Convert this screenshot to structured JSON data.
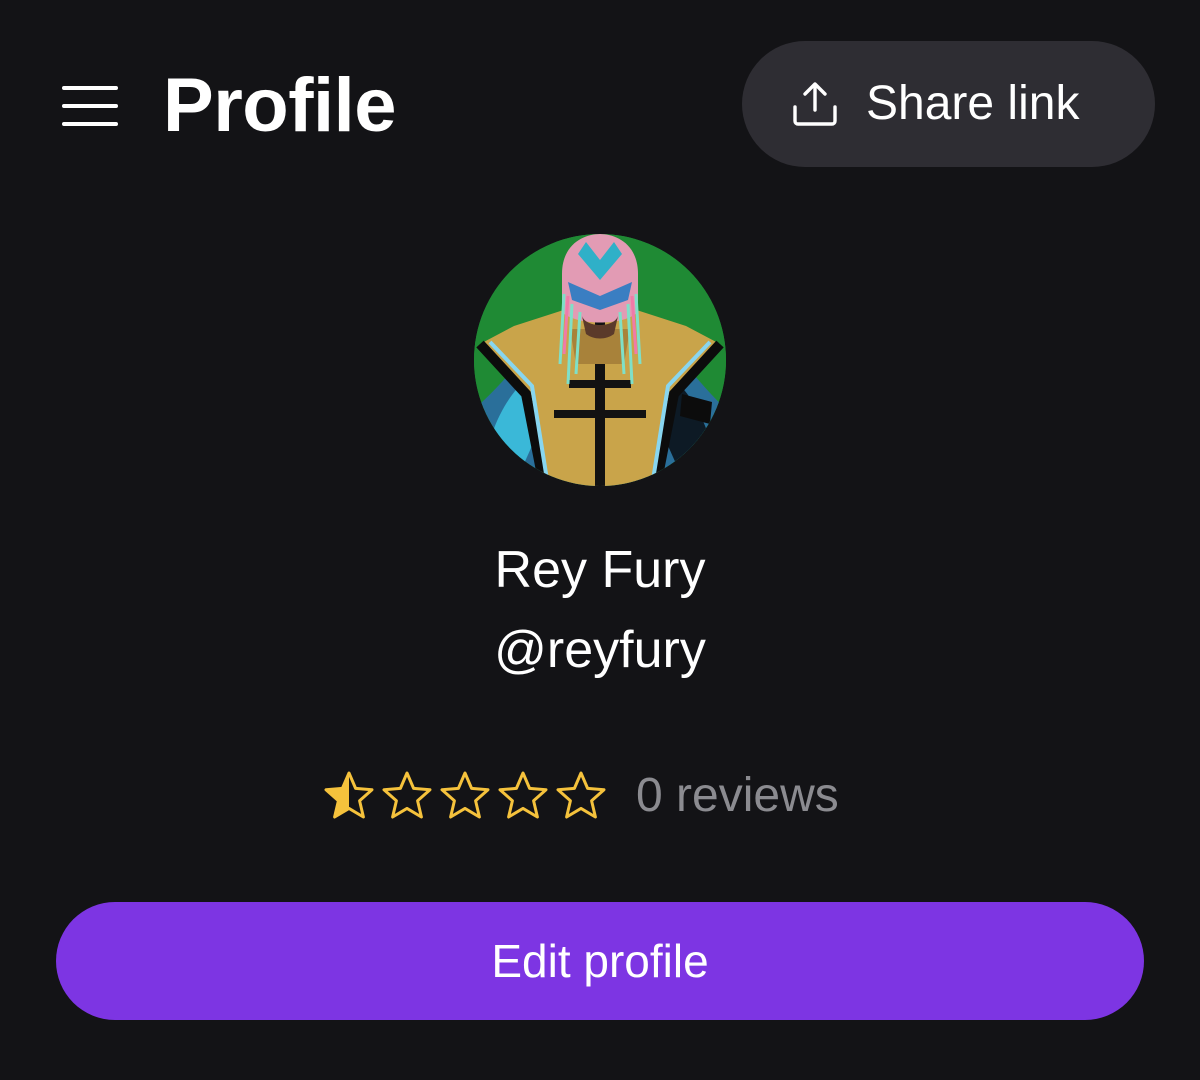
{
  "header": {
    "title": "Profile",
    "menu_icon": "hamburger-menu-icon",
    "share_button": {
      "label": "Share link",
      "icon": "share-upload-icon"
    }
  },
  "profile": {
    "display_name": "Rey Fury",
    "username": "@reyfury",
    "avatar_background": "#1f8a34"
  },
  "rating": {
    "value": 0.5,
    "max": 5,
    "star_color": "#f5c23c",
    "review_count_label": "0 reviews"
  },
  "actions": {
    "edit_profile_label": "Edit profile"
  },
  "colors": {
    "background": "#131316",
    "share_button_bg": "#2e2d33",
    "accent": "#7d35e3",
    "muted_text": "#8b8b90"
  }
}
